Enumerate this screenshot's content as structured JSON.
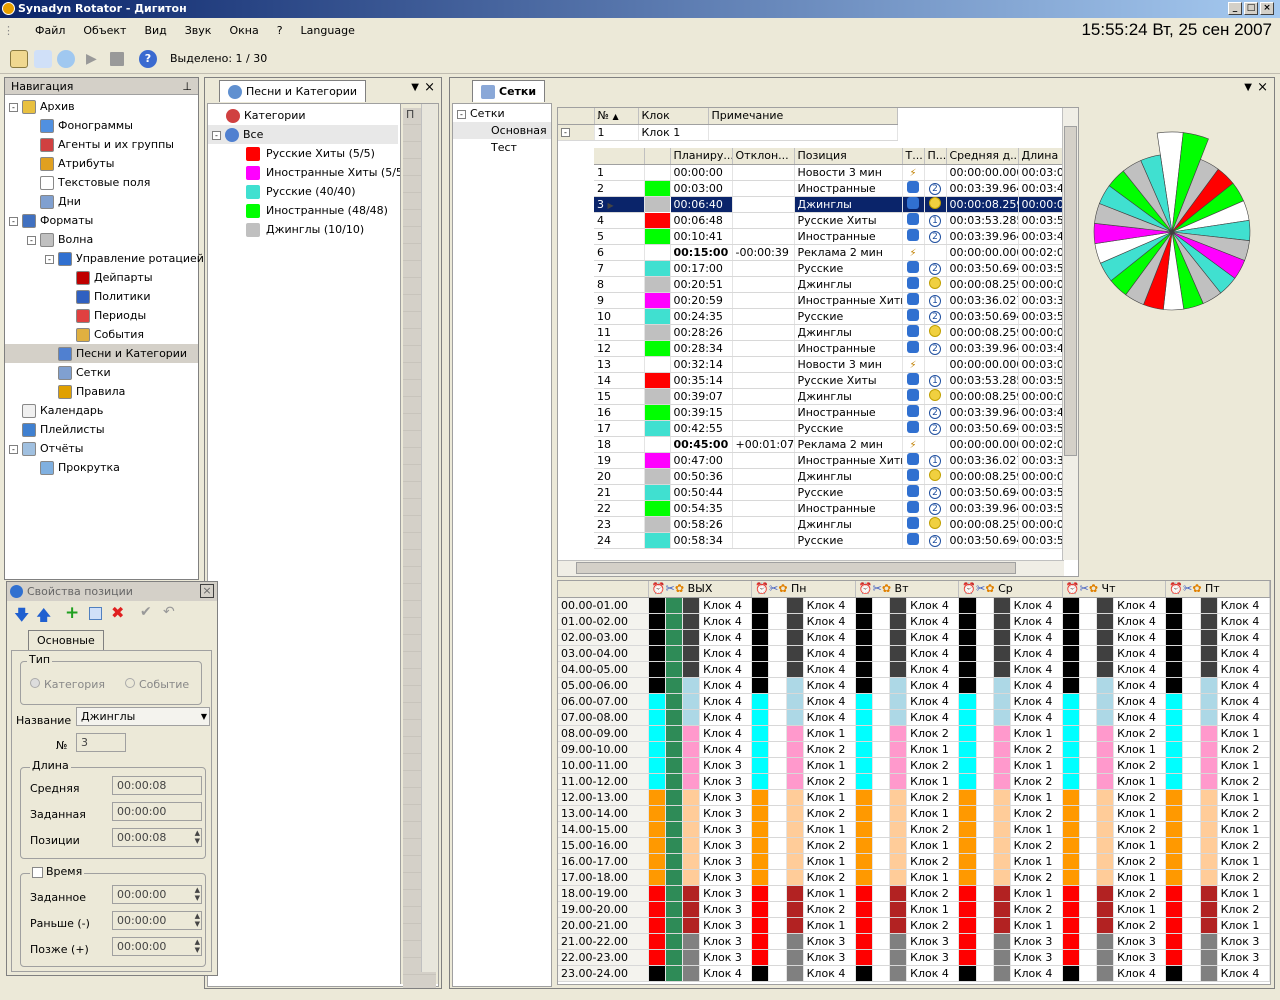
{
  "window": {
    "title": "Synadyn Rotator - Дигитон",
    "clock": "15:55:24 Вт, 25 сен 2007"
  },
  "menu": [
    "Файл",
    "Объект",
    "Вид",
    "Звук",
    "Окна",
    "?",
    "Language"
  ],
  "toolbar": {
    "selected": "Выделено: 1 / 30"
  },
  "nav": {
    "title": "Навигация",
    "items": [
      {
        "label": "Архив",
        "level": 0,
        "exp": "-",
        "icon": "archive-icon"
      },
      {
        "label": "Фонограммы",
        "level": 1,
        "icon": "phonogram-icon"
      },
      {
        "label": "Агенты и их группы",
        "level": 1,
        "icon": "agents-icon"
      },
      {
        "label": "Атрибуты",
        "level": 1,
        "icon": "attributes-icon"
      },
      {
        "label": "Текстовые поля",
        "level": 1,
        "icon": "text-fields-icon"
      },
      {
        "label": "Дни",
        "level": 1,
        "icon": "days-icon"
      },
      {
        "label": "Форматы",
        "level": 0,
        "exp": "-",
        "icon": "formats-icon"
      },
      {
        "label": "Волна",
        "level": 1,
        "exp": "-",
        "icon": "wave-icon"
      },
      {
        "label": "Управление ротацией",
        "level": 2,
        "exp": "-",
        "icon": "rotation-icon"
      },
      {
        "label": "Дейпарты",
        "level": 3,
        "icon": "dayparts-icon"
      },
      {
        "label": "Политики",
        "level": 3,
        "icon": "policies-icon"
      },
      {
        "label": "Периоды",
        "level": 3,
        "icon": "periods-icon"
      },
      {
        "label": "События",
        "level": 3,
        "icon": "events-icon"
      },
      {
        "label": "Песни и Категории",
        "level": 2,
        "icon": "songs-icon",
        "selected": true
      },
      {
        "label": "Сетки",
        "level": 2,
        "icon": "grids-icon"
      },
      {
        "label": "Правила",
        "level": 2,
        "icon": "rules-icon"
      },
      {
        "label": "Календарь",
        "level": 0,
        "icon": "calendar-icon"
      },
      {
        "label": "Плейлисты",
        "level": 0,
        "icon": "playlists-icon"
      },
      {
        "label": "Отчёты",
        "level": 0,
        "exp": "-",
        "icon": "reports-icon"
      },
      {
        "label": "Прокрутка",
        "level": 1,
        "icon": "scroll-icon"
      }
    ]
  },
  "songs": {
    "tab": "Песни и Категории",
    "root": "Категории",
    "all": "Все",
    "cats": [
      {
        "label": "Русские Хиты (5/5)",
        "color": "#ff0000"
      },
      {
        "label": "Иностранные Хиты (5/5)",
        "color": "#ff00ff"
      },
      {
        "label": "Русские (40/40)",
        "color": "#40e0d0"
      },
      {
        "label": "Иностранные (48/48)",
        "color": "#00ff00"
      },
      {
        "label": "Джинглы (10/10)",
        "color": "#c0c0c0"
      }
    ],
    "colhdr": "П"
  },
  "props": {
    "title": "Свойства позиции",
    "tab": "Основные",
    "type_label": "Тип",
    "opt1": "Категория",
    "opt2": "Событие",
    "name_label": "Название",
    "name_value": "Джинглы",
    "no_label": "№",
    "no_value": "3",
    "len_label": "Длина",
    "avg_label": "Средняя",
    "avg_value": "00:00:08",
    "set_label": "Заданная",
    "set_value": "00:00:00",
    "pos_label": "Позиции",
    "pos_value": "00:00:08",
    "time_label": "Время",
    "tset_label": "Заданное",
    "tset_value": "00:00:00",
    "early_label": "Раньше (-)",
    "early_value": "00:00:00",
    "late_label": "Позже (+)",
    "late_value": "00:00:00"
  },
  "grids": {
    "tab": "Сетки",
    "tree": [
      "Сетки",
      "Основная",
      "Тест"
    ],
    "clockhdr": [
      "№",
      "Клок",
      "Примечание"
    ],
    "clockrow": [
      "1",
      "Клок 1",
      ""
    ],
    "cols": [
      "Планиру...",
      "Отклон...",
      "Позиция",
      "Т...",
      "П...",
      "Средняя д...",
      "Длина"
    ],
    "rows": [
      [
        "1",
        "#ffffff",
        "00:00:00",
        "",
        "Новости 3 мин",
        "b",
        "",
        "00:00:00.000",
        "00:03:0"
      ],
      [
        "2",
        "#00ff00",
        "00:03:00",
        "",
        "Иностранные",
        "d",
        "2",
        "00:03:39.964",
        "00:03:4"
      ],
      [
        "3",
        "#c0c0c0",
        "00:06:40",
        "",
        "Джинглы",
        "d",
        "o",
        "00:00:08.259",
        "00:00:0"
      ],
      [
        "4",
        "#ff0000",
        "00:06:48",
        "",
        "Русские Хиты",
        "d",
        "1",
        "00:03:53.285",
        "00:03:5"
      ],
      [
        "5",
        "#00ff00",
        "00:10:41",
        "",
        "Иностранные",
        "d",
        "2",
        "00:03:39.964",
        "00:03:4"
      ],
      [
        "6",
        "#ffffff",
        "00:15:00",
        "-00:00:39",
        "Реклама 2 мин",
        "b",
        "",
        "00:00:00.000",
        "00:02:0"
      ],
      [
        "7",
        "#40e0d0",
        "00:17:00",
        "",
        "Русские",
        "d",
        "2",
        "00:03:50.694",
        "00:03:5"
      ],
      [
        "8",
        "#c0c0c0",
        "00:20:51",
        "",
        "Джинглы",
        "d",
        "o",
        "00:00:08.259",
        "00:00:0"
      ],
      [
        "9",
        "#ff00ff",
        "00:20:59",
        "",
        "Иностранные Хиты",
        "d",
        "1",
        "00:03:36.027",
        "00:03:3"
      ],
      [
        "10",
        "#40e0d0",
        "00:24:35",
        "",
        "Русские",
        "d",
        "2",
        "00:03:50.694",
        "00:03:5"
      ],
      [
        "11",
        "#c0c0c0",
        "00:28:26",
        "",
        "Джинглы",
        "d",
        "o",
        "00:00:08.259",
        "00:00:0"
      ],
      [
        "12",
        "#00ff00",
        "00:28:34",
        "",
        "Иностранные",
        "d",
        "2",
        "00:03:39.964",
        "00:03:4"
      ],
      [
        "13",
        "#ffffff",
        "00:32:14",
        "",
        "Новости 3 мин",
        "b",
        "",
        "00:00:00.000",
        "00:03:0"
      ],
      [
        "14",
        "#ff0000",
        "00:35:14",
        "",
        "Русские Хиты",
        "d",
        "1",
        "00:03:53.285",
        "00:03:5"
      ],
      [
        "15",
        "#c0c0c0",
        "00:39:07",
        "",
        "Джинглы",
        "d",
        "o",
        "00:00:08.259",
        "00:00:0"
      ],
      [
        "16",
        "#00ff00",
        "00:39:15",
        "",
        "Иностранные",
        "d",
        "2",
        "00:03:39.964",
        "00:03:4"
      ],
      [
        "17",
        "#40e0d0",
        "00:42:55",
        "",
        "Русские",
        "d",
        "2",
        "00:03:50.694",
        "00:03:5"
      ],
      [
        "18",
        "#ffffff",
        "00:45:00",
        "+00:01:07",
        "Реклама 2 мин",
        "b",
        "",
        "00:00:00.000",
        "00:02:0"
      ],
      [
        "19",
        "#ff00ff",
        "00:47:00",
        "",
        "Иностранные Хиты",
        "d",
        "1",
        "00:03:36.027",
        "00:03:3"
      ],
      [
        "20",
        "#c0c0c0",
        "00:50:36",
        "",
        "Джинглы",
        "d",
        "o",
        "00:00:08.259",
        "00:00:0"
      ],
      [
        "21",
        "#40e0d0",
        "00:50:44",
        "",
        "Русские",
        "d",
        "2",
        "00:03:50.694",
        "00:03:5"
      ],
      [
        "22",
        "#00ff00",
        "00:54:35",
        "",
        "Иностранные",
        "d",
        "2",
        "00:03:39.964",
        "00:03:5"
      ],
      [
        "23",
        "#c0c0c0",
        "00:58:26",
        "",
        "Джинглы",
        "d",
        "o",
        "00:00:08.259",
        "00:00:0"
      ],
      [
        "24",
        "#40e0d0",
        "00:58:34",
        "",
        "Русские",
        "d",
        "2",
        "00:03:50.694",
        "00:03:5"
      ]
    ],
    "wheel": [
      "#ffffff",
      "#00ff00",
      "#c0c0c0",
      "#ff0000",
      "#00ff00",
      "#ffffff",
      "#40e0d0",
      "#c0c0c0",
      "#ff00ff",
      "#40e0d0",
      "#c0c0c0",
      "#00ff00",
      "#ffffff",
      "#ff0000",
      "#c0c0c0",
      "#00ff00",
      "#40e0d0",
      "#ffffff",
      "#ff00ff",
      "#c0c0c0",
      "#40e0d0",
      "#00ff00",
      "#c0c0c0",
      "#40e0d0"
    ]
  },
  "week": {
    "days": [
      "ВЫХ",
      "Пн",
      "Вт",
      "Ср",
      "Чт",
      "Пт"
    ],
    "hours": [
      "00.00-01.00",
      "01.00-02.00",
      "02.00-03.00",
      "03.00-04.00",
      "04.00-05.00",
      "05.00-06.00",
      "06.00-07.00",
      "07.00-08.00",
      "08.00-09.00",
      "09.00-10.00",
      "10.00-11.00",
      "11.00-12.00",
      "12.00-13.00",
      "13.00-14.00",
      "14.00-15.00",
      "15.00-16.00",
      "16.00-17.00",
      "17.00-18.00",
      "18.00-19.00",
      "19.00-20.00",
      "20.00-21.00",
      "21.00-22.00",
      "22.00-23.00",
      "23.00-24.00"
    ],
    "colors": [
      [
        "#000000",
        "#2e8b57",
        "#404040"
      ],
      [
        "#000000",
        "#2e8b57",
        "#404040"
      ],
      [
        "#000000",
        "#2e8b57",
        "#404040"
      ],
      [
        "#000000",
        "#2e8b57",
        "#404040"
      ],
      [
        "#000000",
        "#2e8b57",
        "#404040"
      ],
      [
        "#000000",
        "#2e8b57",
        "#add8e6"
      ],
      [
        "#00ffff",
        "#2e8b57",
        "#add8e6"
      ],
      [
        "#00ffff",
        "#2e8b57",
        "#add8e6"
      ],
      [
        "#00ffff",
        "#2e8b57",
        "#ff99cc"
      ],
      [
        "#00ffff",
        "#2e8b57",
        "#ff99cc"
      ],
      [
        "#00ffff",
        "#2e8b57",
        "#ff99cc"
      ],
      [
        "#00ffff",
        "#2e8b57",
        "#ff99cc"
      ],
      [
        "#ff9900",
        "#2e8b57",
        "#ffcc99"
      ],
      [
        "#ff9900",
        "#2e8b57",
        "#ffcc99"
      ],
      [
        "#ff9900",
        "#2e8b57",
        "#ffcc99"
      ],
      [
        "#ff9900",
        "#2e8b57",
        "#ffcc99"
      ],
      [
        "#ff9900",
        "#2e8b57",
        "#ffcc99"
      ],
      [
        "#ff9900",
        "#2e8b57",
        "#ffcc99"
      ],
      [
        "#ff0000",
        "#2e8b57",
        "#b22222"
      ],
      [
        "#ff0000",
        "#2e8b57",
        "#b22222"
      ],
      [
        "#ff0000",
        "#2e8b57",
        "#b22222"
      ],
      [
        "#ff0000",
        "#2e8b57",
        "#808080"
      ],
      [
        "#ff0000",
        "#2e8b57",
        "#808080"
      ],
      [
        "#000000",
        "#2e8b57",
        "#808080"
      ]
    ],
    "clocks": [
      [
        "Клок 4",
        "Клок 4",
        "Клок 4",
        "Клок 4",
        "Клок 4",
        "Клок 4"
      ],
      [
        "Клок 4",
        "Клок 4",
        "Клок 4",
        "Клок 4",
        "Клок 4",
        "Клок 4"
      ],
      [
        "Клок 4",
        "Клок 4",
        "Клок 4",
        "Клок 4",
        "Клок 4",
        "Клок 4"
      ],
      [
        "Клок 4",
        "Клок 4",
        "Клок 4",
        "Клок 4",
        "Клок 4",
        "Клок 4"
      ],
      [
        "Клок 4",
        "Клок 4",
        "Клок 4",
        "Клок 4",
        "Клок 4",
        "Клок 4"
      ],
      [
        "Клок 4",
        "Клок 4",
        "Клок 4",
        "Клок 4",
        "Клок 4",
        "Клок 4"
      ],
      [
        "Клок 4",
        "Клок 4",
        "Клок 4",
        "Клок 4",
        "Клок 4",
        "Клок 4"
      ],
      [
        "Клок 4",
        "Клок 4",
        "Клок 4",
        "Клок 4",
        "Клок 4",
        "Клок 4"
      ],
      [
        "Клок 4",
        "Клок 1",
        "Клок 2",
        "Клок 1",
        "Клок 2",
        "Клок 1"
      ],
      [
        "Клок 4",
        "Клок 2",
        "Клок 1",
        "Клок 2",
        "Клок 1",
        "Клок 2"
      ],
      [
        "Клок 3",
        "Клок 1",
        "Клок 2",
        "Клок 1",
        "Клок 2",
        "Клок 1"
      ],
      [
        "Клок 3",
        "Клок 2",
        "Клок 1",
        "Клок 2",
        "Клок 1",
        "Клок 2"
      ],
      [
        "Клок 3",
        "Клок 1",
        "Клок 2",
        "Клок 1",
        "Клок 2",
        "Клок 1"
      ],
      [
        "Клок 3",
        "Клок 2",
        "Клок 1",
        "Клок 2",
        "Клок 1",
        "Клок 2"
      ],
      [
        "Клок 3",
        "Клок 1",
        "Клок 2",
        "Клок 1",
        "Клок 2",
        "Клок 1"
      ],
      [
        "Клок 3",
        "Клок 2",
        "Клок 1",
        "Клок 2",
        "Клок 1",
        "Клок 2"
      ],
      [
        "Клок 3",
        "Клок 1",
        "Клок 2",
        "Клок 1",
        "Клок 2",
        "Клок 1"
      ],
      [
        "Клок 3",
        "Клок 2",
        "Клок 1",
        "Клок 2",
        "Клок 1",
        "Клок 2"
      ],
      [
        "Клок 3",
        "Клок 1",
        "Клок 2",
        "Клок 1",
        "Клок 2",
        "Клок 1"
      ],
      [
        "Клок 3",
        "Клок 2",
        "Клок 1",
        "Клок 2",
        "Клок 1",
        "Клок 2"
      ],
      [
        "Клок 3",
        "Клок 1",
        "Клок 2",
        "Клок 1",
        "Клок 2",
        "Клок 1"
      ],
      [
        "Клок 3",
        "Клок 3",
        "Клок 3",
        "Клок 3",
        "Клок 3",
        "Клок 3"
      ],
      [
        "Клок 3",
        "Клок 3",
        "Клок 3",
        "Клок 3",
        "Клок 3",
        "Клок 3"
      ],
      [
        "Клок 4",
        "Клок 4",
        "Клок 4",
        "Клок 4",
        "Клок 4",
        "Клок 4"
      ]
    ]
  }
}
